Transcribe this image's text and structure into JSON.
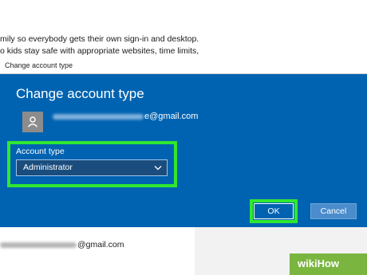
{
  "background": {
    "line1": "mily so everybody gets their own sign-in and desktop.",
    "line2": "o kids stay safe with appropriate websites, time limits,",
    "bottom_email_suffix": "@gmail.com"
  },
  "dialog": {
    "window_title": "Change account type",
    "heading": "Change account type",
    "email_suffix": "e@gmail.com",
    "account_type_label": "Account type",
    "account_type_value": "Administrator",
    "ok_label": "OK",
    "cancel_label": "Cancel"
  },
  "watermark": {
    "text": "wikiHow"
  },
  "colors": {
    "dialog_blue": "#0063b1",
    "highlight": "#30e830"
  },
  "icons": [
    "user-icon",
    "chevron-down-icon"
  ]
}
